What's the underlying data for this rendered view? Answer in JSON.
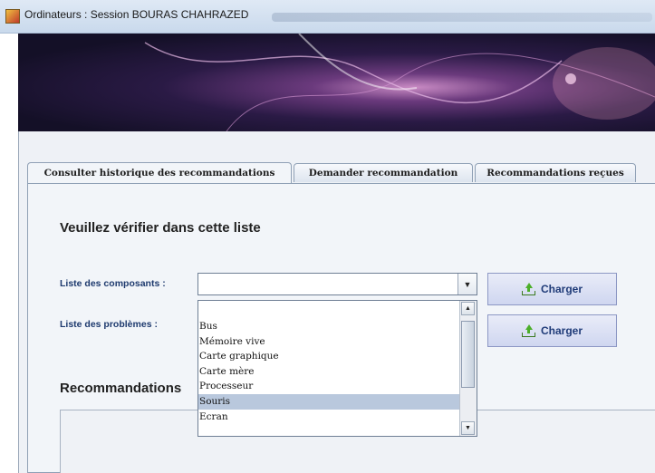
{
  "window": {
    "title": "Ordinateurs : Session BOURAS CHAHRAZED",
    "icon": "java-app-icon"
  },
  "tabs": [
    {
      "label": "Consulter historique des recommandations",
      "active": true
    },
    {
      "label": "Demander recommandation",
      "active": false
    },
    {
      "label": "Recommandations reçues",
      "active": false
    }
  ],
  "panel": {
    "heading": "Veuillez vérifier dans cette liste",
    "components_label": "Liste des composants :",
    "problems_label": "Liste des problèmes :",
    "components_value": "",
    "load_button_1": "Charger",
    "load_button_2": "Charger",
    "load_icon": "upload-icon",
    "recommendations_title": "Recommandations"
  },
  "dropdown": {
    "items": [
      "Bus",
      "Mémoire vive",
      "Carte graphique",
      "Carte mère",
      "Processeur",
      "Souris",
      "Ecran"
    ],
    "selected": "Souris"
  },
  "colors": {
    "label_text": "#1e3a6e",
    "button_text": "#1f3b78",
    "selection": "#b9c8dd"
  }
}
